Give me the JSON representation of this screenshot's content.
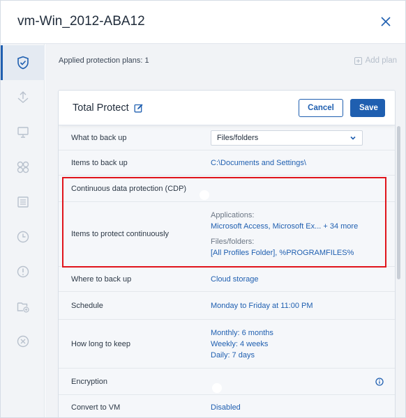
{
  "window": {
    "title": "vm-Win_2012-ABA12"
  },
  "sidebar": {
    "items": [
      {
        "name": "shield-check-icon",
        "active": true
      },
      {
        "name": "recovery-icon"
      },
      {
        "name": "monitor-icon"
      },
      {
        "name": "activities-icon"
      },
      {
        "name": "document-list-icon"
      },
      {
        "name": "clock-icon"
      },
      {
        "name": "alert-icon"
      },
      {
        "name": "folder-add-icon"
      },
      {
        "name": "cancel-icon"
      }
    ]
  },
  "plans_bar": {
    "applied_text": "Applied protection plans: 1",
    "add_plan_label": "Add plan"
  },
  "plan": {
    "name": "Total Protect",
    "cancel_label": "Cancel",
    "save_label": "Save",
    "rows": {
      "what": {
        "label": "What to back up",
        "value": "Files/folders"
      },
      "items": {
        "label": "Items to back up",
        "value": "C:\\Documents and Settings\\"
      },
      "cdp": {
        "label": "Continuous data protection (CDP)",
        "state": "on"
      },
      "protect": {
        "label": "Items to protect continuously",
        "apps_heading": "Applications:",
        "apps_value": "Microsoft Access, Microsoft Ex... + 34 more",
        "files_heading": "Files/folders:",
        "files_value": "[All Profiles Folder], %PROGRAMFILES%"
      },
      "where": {
        "label": "Where to back up",
        "value": "Cloud storage"
      },
      "schedule": {
        "label": "Schedule",
        "value": "Monday to Friday at 11:00 PM"
      },
      "keep": {
        "label": "How long to keep",
        "monthly": "Monthly: 6 months",
        "weekly": "Weekly: 4 weeks",
        "daily": "Daily: 7 days"
      },
      "encryption": {
        "label": "Encryption",
        "state": "off"
      },
      "convert": {
        "label": "Convert to VM",
        "value": "Disabled"
      }
    }
  },
  "colors": {
    "accent": "#1f5fb0",
    "toggle_on": "#6bb23c",
    "toggle_off": "#aeb9ca",
    "highlight": "#e0141b"
  }
}
